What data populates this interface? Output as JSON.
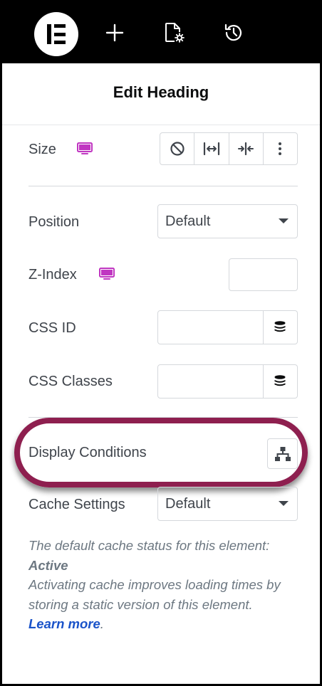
{
  "toolbar": {
    "logo_icon": "elementor-logo-icon",
    "add_icon": "plus-icon",
    "page_settings_icon": "page-settings-icon",
    "history_icon": "history-icon"
  },
  "panel": {
    "title": "Edit Heading"
  },
  "size": {
    "label": "Size",
    "responsive_icon": "desktop-icon",
    "options": [
      "none-icon",
      "full-width-icon",
      "inline-icon",
      "more-options-icon"
    ]
  },
  "position": {
    "label": "Position",
    "value": "Default"
  },
  "z_index": {
    "label": "Z-Index",
    "responsive_icon": "desktop-icon",
    "value": ""
  },
  "css_id": {
    "label": "CSS ID",
    "value": "",
    "dynamic_icon": "dynamic-tags-icon"
  },
  "css_classes": {
    "label": "CSS Classes",
    "value": "",
    "dynamic_icon": "dynamic-tags-icon"
  },
  "display_conditions": {
    "label": "Display Conditions",
    "button_icon": "sitemap-icon",
    "highlight_color": "#8e1f4f"
  },
  "cache_settings": {
    "label": "Cache Settings",
    "value": "Default"
  },
  "description": {
    "line1": "The default cache status for this element:",
    "status": "Active",
    "line2": "Activating cache improves loading times by storing a static version of this element.",
    "link": "Learn more",
    "period": "."
  },
  "colors": {
    "accent_pink": "#c036c1",
    "link_blue": "#1a53c9"
  }
}
